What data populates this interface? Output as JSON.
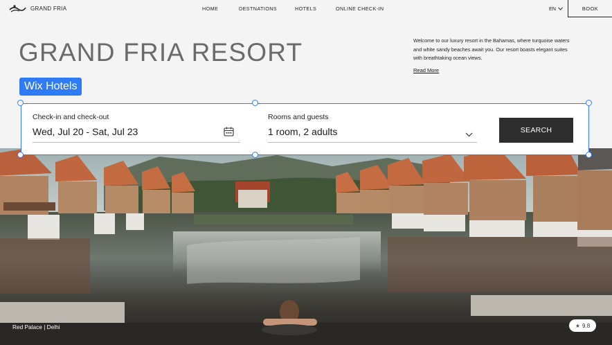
{
  "header": {
    "logo_text": "GRAND FRIA",
    "nav": [
      {
        "label": "HOME"
      },
      {
        "label": "DESTNATIONS"
      },
      {
        "label": "HOTELS"
      },
      {
        "label": "ONLINE CHECK-IN"
      }
    ],
    "language": "EN",
    "book_label": "BOOK"
  },
  "hero": {
    "title": "GRAND FRIA RESORT",
    "description": "Welcome to our luxury resort in the Bahamas, where turquoise waters and white sandy beaches await you. Our resort boasts elegant suites with breathtaking ocean views.",
    "read_more": "Read More"
  },
  "wix_label": "Wix Hotels",
  "booking": {
    "dates_label": "Check-in and check-out",
    "dates_value": "Wed, Jul 20 - Sat, Jul 23",
    "guests_label": "Rooms and guests",
    "guests_value": "1 room, 2 adults",
    "search_label": "SEARCH"
  },
  "photo": {
    "caption": "Red Palace | Delhi",
    "rating": "9.8"
  },
  "icons": {
    "calendar": "calendar-icon",
    "chevron": "chevron-down-icon",
    "star": "star-icon",
    "logo": "wave-logo-icon"
  },
  "colors": {
    "accent": "#2f7bf6",
    "search_button": "#2e2e2e",
    "title": "#6a6a6a"
  }
}
